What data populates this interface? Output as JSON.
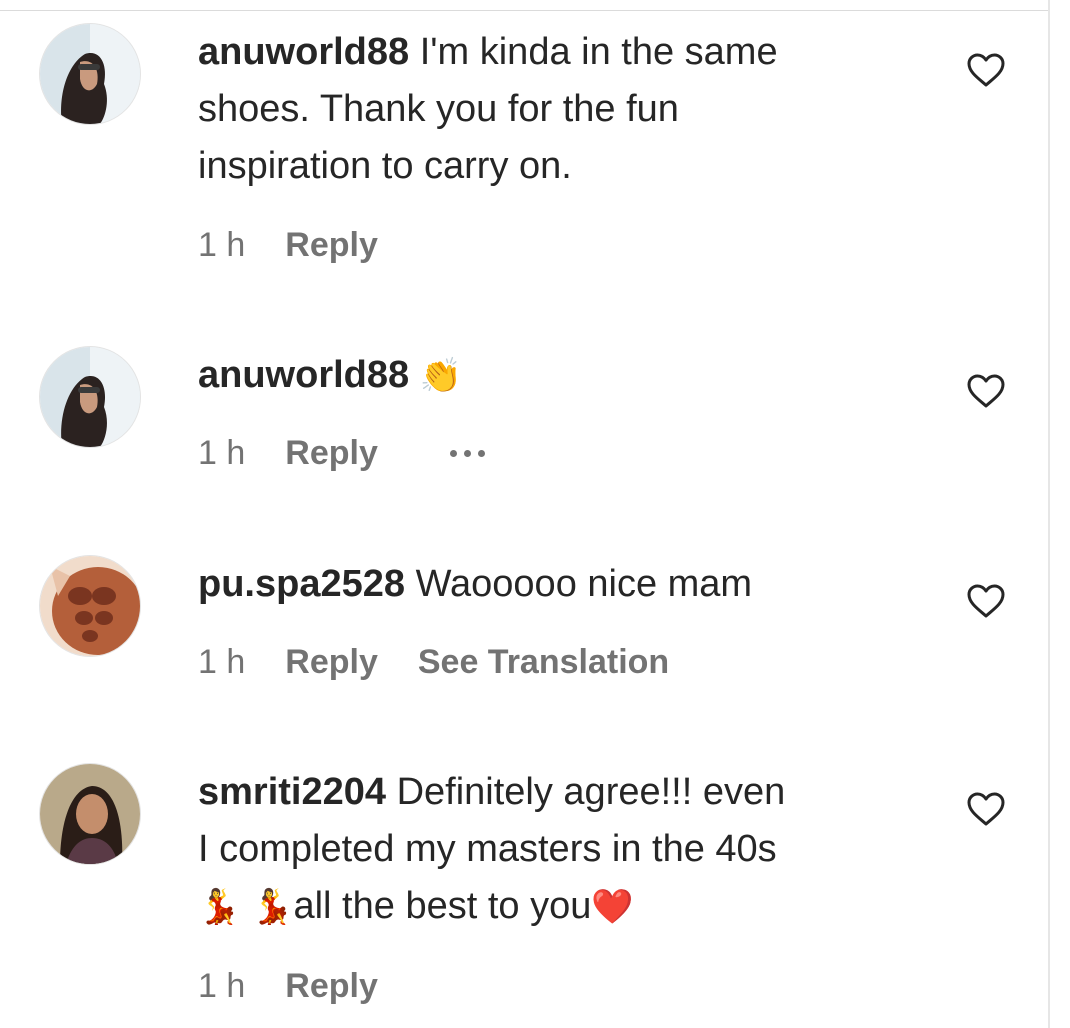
{
  "comments": [
    {
      "username": "anuworld88",
      "text_lines": [
        "I'm kinda in the same",
        "shoes. Thank you for the fun",
        "inspiration to carry on."
      ],
      "time": "1 h",
      "reply_label": "Reply"
    },
    {
      "username": "anuworld88",
      "emoji": "👏",
      "time": "1 h",
      "reply_label": "Reply",
      "more_icon": "more-horizontal"
    },
    {
      "username": "pu.spa2528",
      "text": "Waooooo nice mam",
      "time": "1 h",
      "reply_label": "Reply",
      "translation_label": "See Translation"
    },
    {
      "username": "smriti2204",
      "line1": "Definitely agree!!! even",
      "line2": "I completed my masters in the 40s",
      "line3_emoji": "💃 💃",
      "line3_text": "all the best to you",
      "line3_heart": "❤️",
      "time": "1 h",
      "reply_label": "Reply"
    }
  ],
  "icons": {
    "like": "heart-outline-icon"
  },
  "colors": {
    "text": "#262626",
    "meta": "#737373",
    "heart_emoji": "#e0245e"
  }
}
